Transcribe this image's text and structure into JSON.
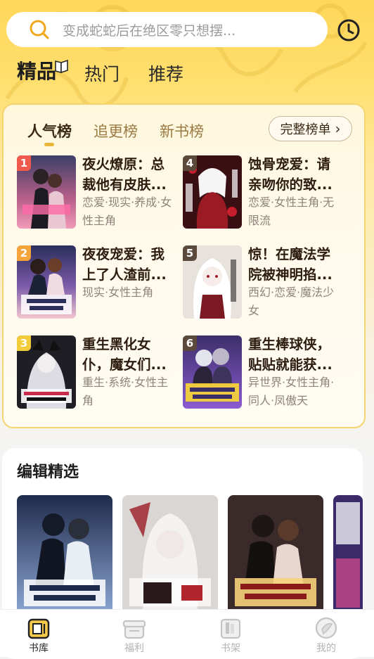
{
  "search": {
    "placeholder": "变成蛇蛇后在绝区零只想摆..."
  },
  "icons": {
    "search": "search-icon",
    "history": "clock-icon"
  },
  "top_tabs": [
    {
      "label": "精品",
      "active": true
    },
    {
      "label": "热门",
      "active": false
    },
    {
      "label": "推荐",
      "active": false
    }
  ],
  "ranking": {
    "tabs": [
      {
        "label": "人气榜",
        "active": true
      },
      {
        "label": "追更榜",
        "active": false
      },
      {
        "label": "新书榜",
        "active": false
      }
    ],
    "full_list_label": "完整榜单",
    "items": [
      {
        "rank": "1",
        "title": "夜火燎原：总裁他有皮肤...",
        "tags": "恋爱·现实·养成·女性主角",
        "badge_color": "#ef5a4c"
      },
      {
        "rank": "2",
        "title": "夜夜宠爱：我上了人渣前...",
        "tags": "现实·女性主角",
        "badge_color": "#f4a43a"
      },
      {
        "rank": "3",
        "title": "重生黑化女仆，魔女们...",
        "tags": "重生·系统·女性主角",
        "badge_color": "#f2cc3a"
      },
      {
        "rank": "4",
        "title": "蚀骨宠爱：请亲吻你的致...",
        "tags": "恋爱·女性主角·无限流",
        "badge_color": "#5b4a3c"
      },
      {
        "rank": "5",
        "title": "惊！在魔法学院被神明掐...",
        "tags": "西幻·恋爱·魔法少女",
        "badge_color": "#5b4a3c"
      },
      {
        "rank": "6",
        "title": "重生棒球侠，贴贴就能获...",
        "tags": "异世界·女性主角·同人·凤傲天",
        "badge_color": "#5b4a3c"
      }
    ]
  },
  "editor_picks": {
    "title": "编辑精选"
  },
  "bottom_nav": [
    {
      "label": "书库",
      "icon": "library-icon",
      "active": true
    },
    {
      "label": "福利",
      "icon": "gift-icon",
      "active": false
    },
    {
      "label": "书架",
      "icon": "bookshelf-icon",
      "active": false
    },
    {
      "label": "我的",
      "icon": "profile-icon",
      "active": false
    }
  ]
}
